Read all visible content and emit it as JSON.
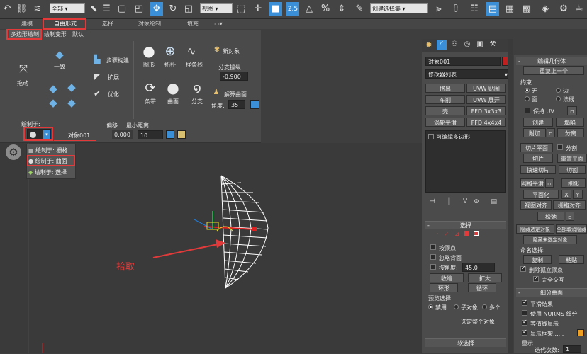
{
  "toolbar": {
    "select_filter": "全部",
    "view_select": "视图",
    "named_selection": "创建选择集",
    "snap_num": "2.5"
  },
  "ribbon_tabs": [
    "建模",
    "自由形式",
    "选择",
    "对象绘制",
    "填充"
  ],
  "panel": {
    "subtabs": [
      "多边形绘制",
      "绘制变形",
      "默认"
    ],
    "tools": {
      "drag": "拖动",
      "conform": "一致",
      "step_build": "步骤构建",
      "extend": "扩展",
      "optimize": "优化",
      "shapes": "图形",
      "topology": "拓扑",
      "splines": "样条线",
      "strips": "条带",
      "surface": "曲面",
      "branches": "分支",
      "new_object": "新对象",
      "branch_factor_label": "分支操纵:",
      "branch_factor": "-0.900",
      "solve_surface": "解算曲面",
      "angle_label": "角度:",
      "angle": "35"
    },
    "draw_on_label": "绘制于:",
    "target_object": "对象001",
    "offset_label": "偏移:",
    "min_dist_label": "最小距离:",
    "offset": "0.000",
    "min_dist": "10"
  },
  "draw_on_menu": [
    "绘制于: 栅格",
    "绘制于: 曲面",
    "绘制于: 选择"
  ],
  "viewport": {
    "annotation": "拾取"
  },
  "cmd_panel": {
    "object_name": "对象001",
    "modifier_list": "修改器列表",
    "buttons": [
      [
        "挤出",
        "UVW 贴图"
      ],
      [
        "车削",
        "UVW 展开"
      ],
      [
        "壳",
        "FFD 3x3x3"
      ],
      [
        "涡轮平滑",
        "FFD 4x4x4"
      ]
    ],
    "stack_item": "可编辑多边形",
    "selection_title": "选择",
    "sel_opts": [
      "按顶点",
      "忽略背面",
      "按角度:"
    ],
    "angle_val": "45.0",
    "shrink": "收缩",
    "grow": "扩大",
    "ring": "环形",
    "loop": "循环",
    "preview_label": "预览选择",
    "preview_opts": [
      "禁用",
      "子对象",
      "多个"
    ],
    "select_all": "选定整个对象",
    "soft_sel": "软选择"
  },
  "edit_geom": {
    "title": "编辑几何体",
    "repeat": "重复上一个",
    "constraints": "约束",
    "c_none": "无",
    "c_edge": "边",
    "c_face": "面",
    "c_normal": "法线",
    "preserve_uv": "保持 UV",
    "create": "创建",
    "collapse": "塌陷",
    "attach": "附加",
    "detach": "分离",
    "slice_plane": "切片平面",
    "split": "分割",
    "slice": "切片",
    "reset_plane": "重置平面",
    "quickslice": "快速切片",
    "cut": "切割",
    "msmooth": "网格平滑",
    "tessellate": "细化",
    "make_planar": "平面化",
    "x": "X",
    "y": "Y",
    "view_align": "视图对齐",
    "grid_align": "栅格对齐",
    "relax": "松弛",
    "hide_sel": "隐藏选定对象",
    "unhide_all": "全部取消隐藏",
    "hide_unsel": "隐藏未选定对象",
    "named_sel": "命名选择:",
    "copy": "复制",
    "paste": "粘贴",
    "del_iso": "删除孤立顶点",
    "full_interact": "完全交互"
  },
  "subdiv": {
    "title": "细分曲面",
    "smooth_result": "平滑结果",
    "use_nurms": "使用 NURMS 细分",
    "iso_display": "等值线显示",
    "show_cage": "显示框架......",
    "display": "显示",
    "iterations_label": "迭代次数:",
    "iterations": "1"
  },
  "colors": {
    "red_highlight": "#e23a3a",
    "accent_blue": "#6fb3e6",
    "swatch_red": "#c02020",
    "swatch_orange": "#f0a020"
  }
}
